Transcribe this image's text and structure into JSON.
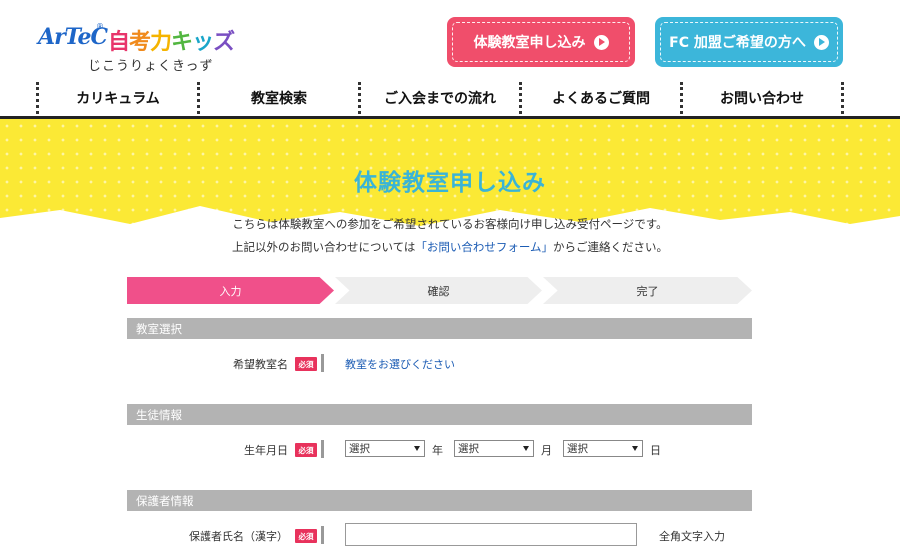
{
  "header": {
    "logo_brand": "ArTeC",
    "logo_reg": "®",
    "logo_name": [
      "自",
      "考",
      "力",
      "キ",
      "ッ",
      "ズ"
    ],
    "logo_sub": "じこうりょくきっず",
    "trial_button": "体験教室申し込み",
    "fc_button": "FC 加盟ご希望の方へ"
  },
  "nav": {
    "items": [
      "カリキュラム",
      "教室検索",
      "ご入会までの流れ",
      "よくあるご質問",
      "お問い合わせ"
    ]
  },
  "hero": {
    "title": "体験教室申し込み"
  },
  "intro": {
    "line1": "こちらは体験教室への参加をご希望されているお客様向け申し込み受付ページです。",
    "line2_prefix": "上記以外のお問い合わせについては",
    "line2_link": "「お問い合わせフォーム」",
    "line2_suffix": "からご連絡ください。"
  },
  "steps": [
    "入力",
    "確認",
    "完了"
  ],
  "sections": {
    "classroom": {
      "title": "教室選択",
      "label": "希望教室名",
      "required": "必須",
      "link": "教室をお選びください"
    },
    "student": {
      "title": "生徒情報",
      "label": "生年月日",
      "required": "必須",
      "year_select": "選択",
      "month_select": "選択",
      "day_select": "選択",
      "year_unit": "年",
      "month_unit": "月",
      "day_unit": "日"
    },
    "guardian": {
      "title": "保護者情報",
      "label": "保護者氏名（漢字）",
      "required": "必須",
      "name_value": "",
      "hint": "全角文字入力"
    }
  },
  "colors": {
    "pink": "#f04e6b",
    "cyan": "#3cb6da",
    "yellow": "#fbe935",
    "step_active": "#f0508a",
    "section_bar": "#b3b3b3"
  }
}
